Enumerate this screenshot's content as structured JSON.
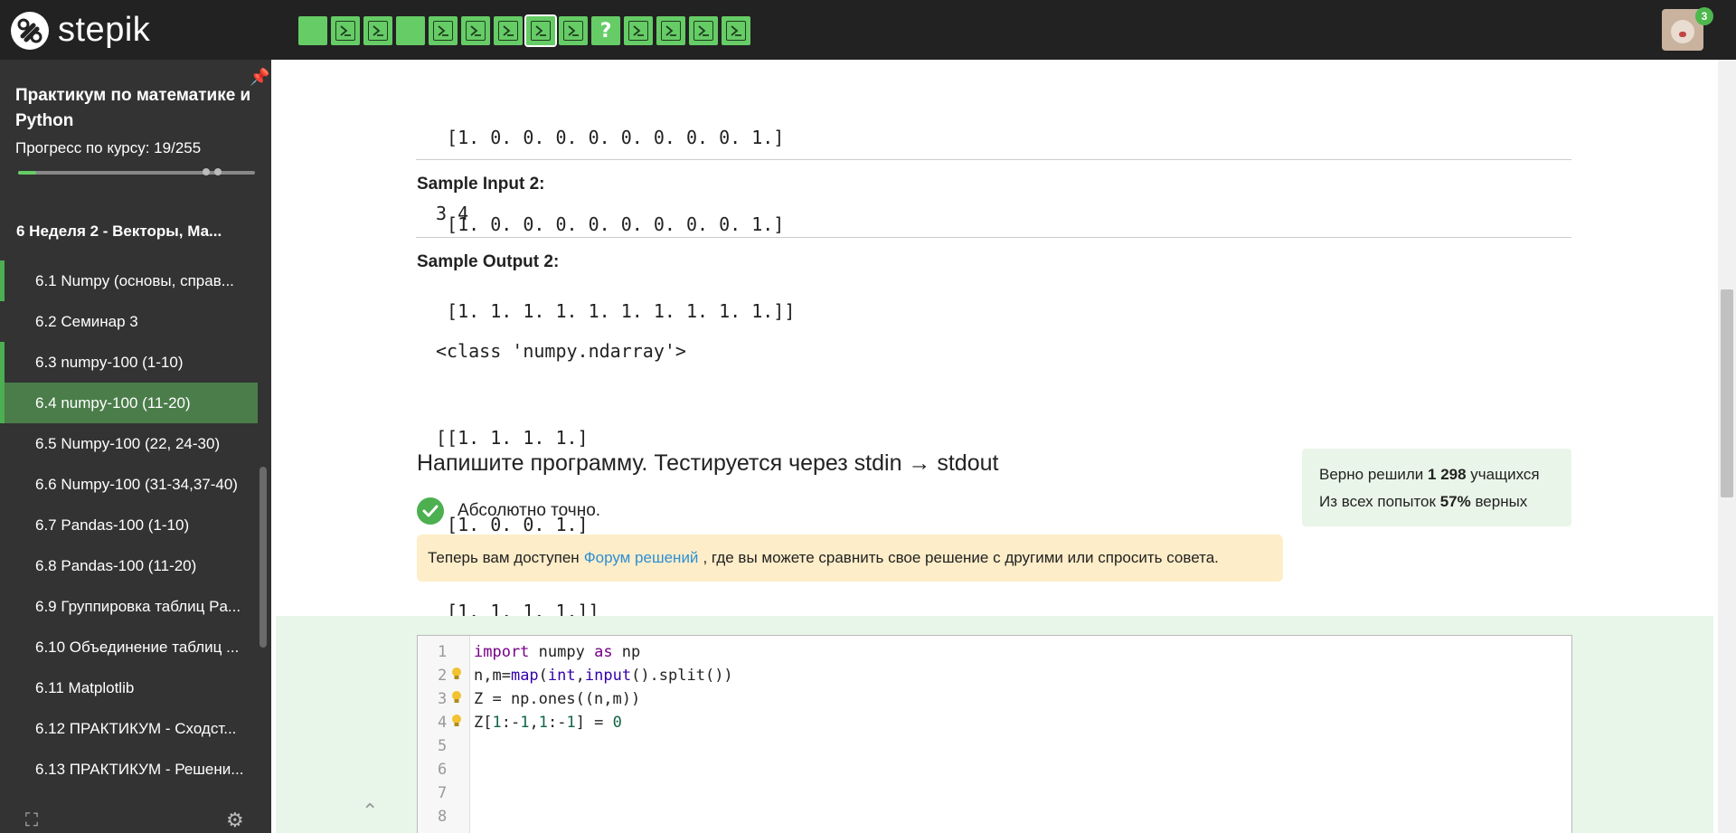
{
  "brand": {
    "name": "stepik"
  },
  "topbar": {
    "steps": [
      {
        "kind": "text"
      },
      {
        "kind": "code"
      },
      {
        "kind": "code"
      },
      {
        "kind": "text"
      },
      {
        "kind": "code"
      },
      {
        "kind": "code"
      },
      {
        "kind": "code"
      },
      {
        "kind": "code",
        "current": true
      },
      {
        "kind": "code"
      },
      {
        "kind": "quiz",
        "label": "?"
      },
      {
        "kind": "code"
      },
      {
        "kind": "code"
      },
      {
        "kind": "code"
      },
      {
        "kind": "code"
      }
    ],
    "notifications_count": "3"
  },
  "sidebar": {
    "course_title": "Практикум по математике и Python",
    "progress_label": "Прогресс по курсу:  19/255",
    "progress_fraction": 0.075,
    "section": "6  Неделя 2 - Векторы, Ма...",
    "items": [
      {
        "label": "6.1  Numpy (основы, справ..."
      },
      {
        "label": "6.2  Семинар 3"
      },
      {
        "label": "6.3  numpy-100 (1-10)"
      },
      {
        "label": "6.4  numpy-100 (11-20)"
      },
      {
        "label": "6.5  Numpy-100 (22, 24-30)"
      },
      {
        "label": "6.6  Numpy-100 (31-34,37-40)"
      },
      {
        "label": "6.7  Pandas-100 (1-10)"
      },
      {
        "label": "6.8  Pandas-100 (11-20)"
      },
      {
        "label": "6.9  Группировка таблиц Pa..."
      },
      {
        "label": "6.10  Объединение таблиц ..."
      },
      {
        "label": "6.11  Matplotlib"
      },
      {
        "label": "6.12  ПРАКТИКУМ - Сходст..."
      },
      {
        "label": "6.13  ПРАКТИКУМ - Решени..."
      }
    ]
  },
  "content": {
    "output1_tail": [
      " [1. 0. 0. 0. 0. 0. 0. 0. 0. 1.]",
      " [1. 0. 0. 0. 0. 0. 0. 0. 0. 1.]",
      " [1. 1. 1. 1. 1. 1. 1. 1. 1. 1.]]"
    ],
    "sample_input2_label": "Sample Input 2:",
    "sample_input2": "3 4",
    "sample_output2_label": "Sample Output 2:",
    "sample_output2": [
      "<class 'numpy.ndarray'>",
      "[[1. 1. 1. 1.]",
      " [1. 0. 0. 1.]",
      " [1. 1. 1. 1.]]"
    ],
    "task_title": "Напишите программу. Тестируется через stdin → stdout",
    "result_text": "Абсолютно точно.",
    "hint_before": "Теперь вам доступен",
    "hint_link": "Форум решений",
    "hint_after": ", где вы можете сравнить свое решение с другими или спросить совета.",
    "stats_line1_before": "Верно решили",
    "stats_line1_value": "1 298",
    "stats_line1_after": "учащихся",
    "stats_line2_before": "Из всех попыток",
    "stats_line2_value": "57%",
    "stats_line2_after": "верных"
  },
  "editor": {
    "line_numbers": [
      "1",
      "2",
      "3",
      "4",
      "5",
      "6",
      "7",
      "8"
    ],
    "hint_lines": [
      2,
      3,
      4
    ]
  }
}
